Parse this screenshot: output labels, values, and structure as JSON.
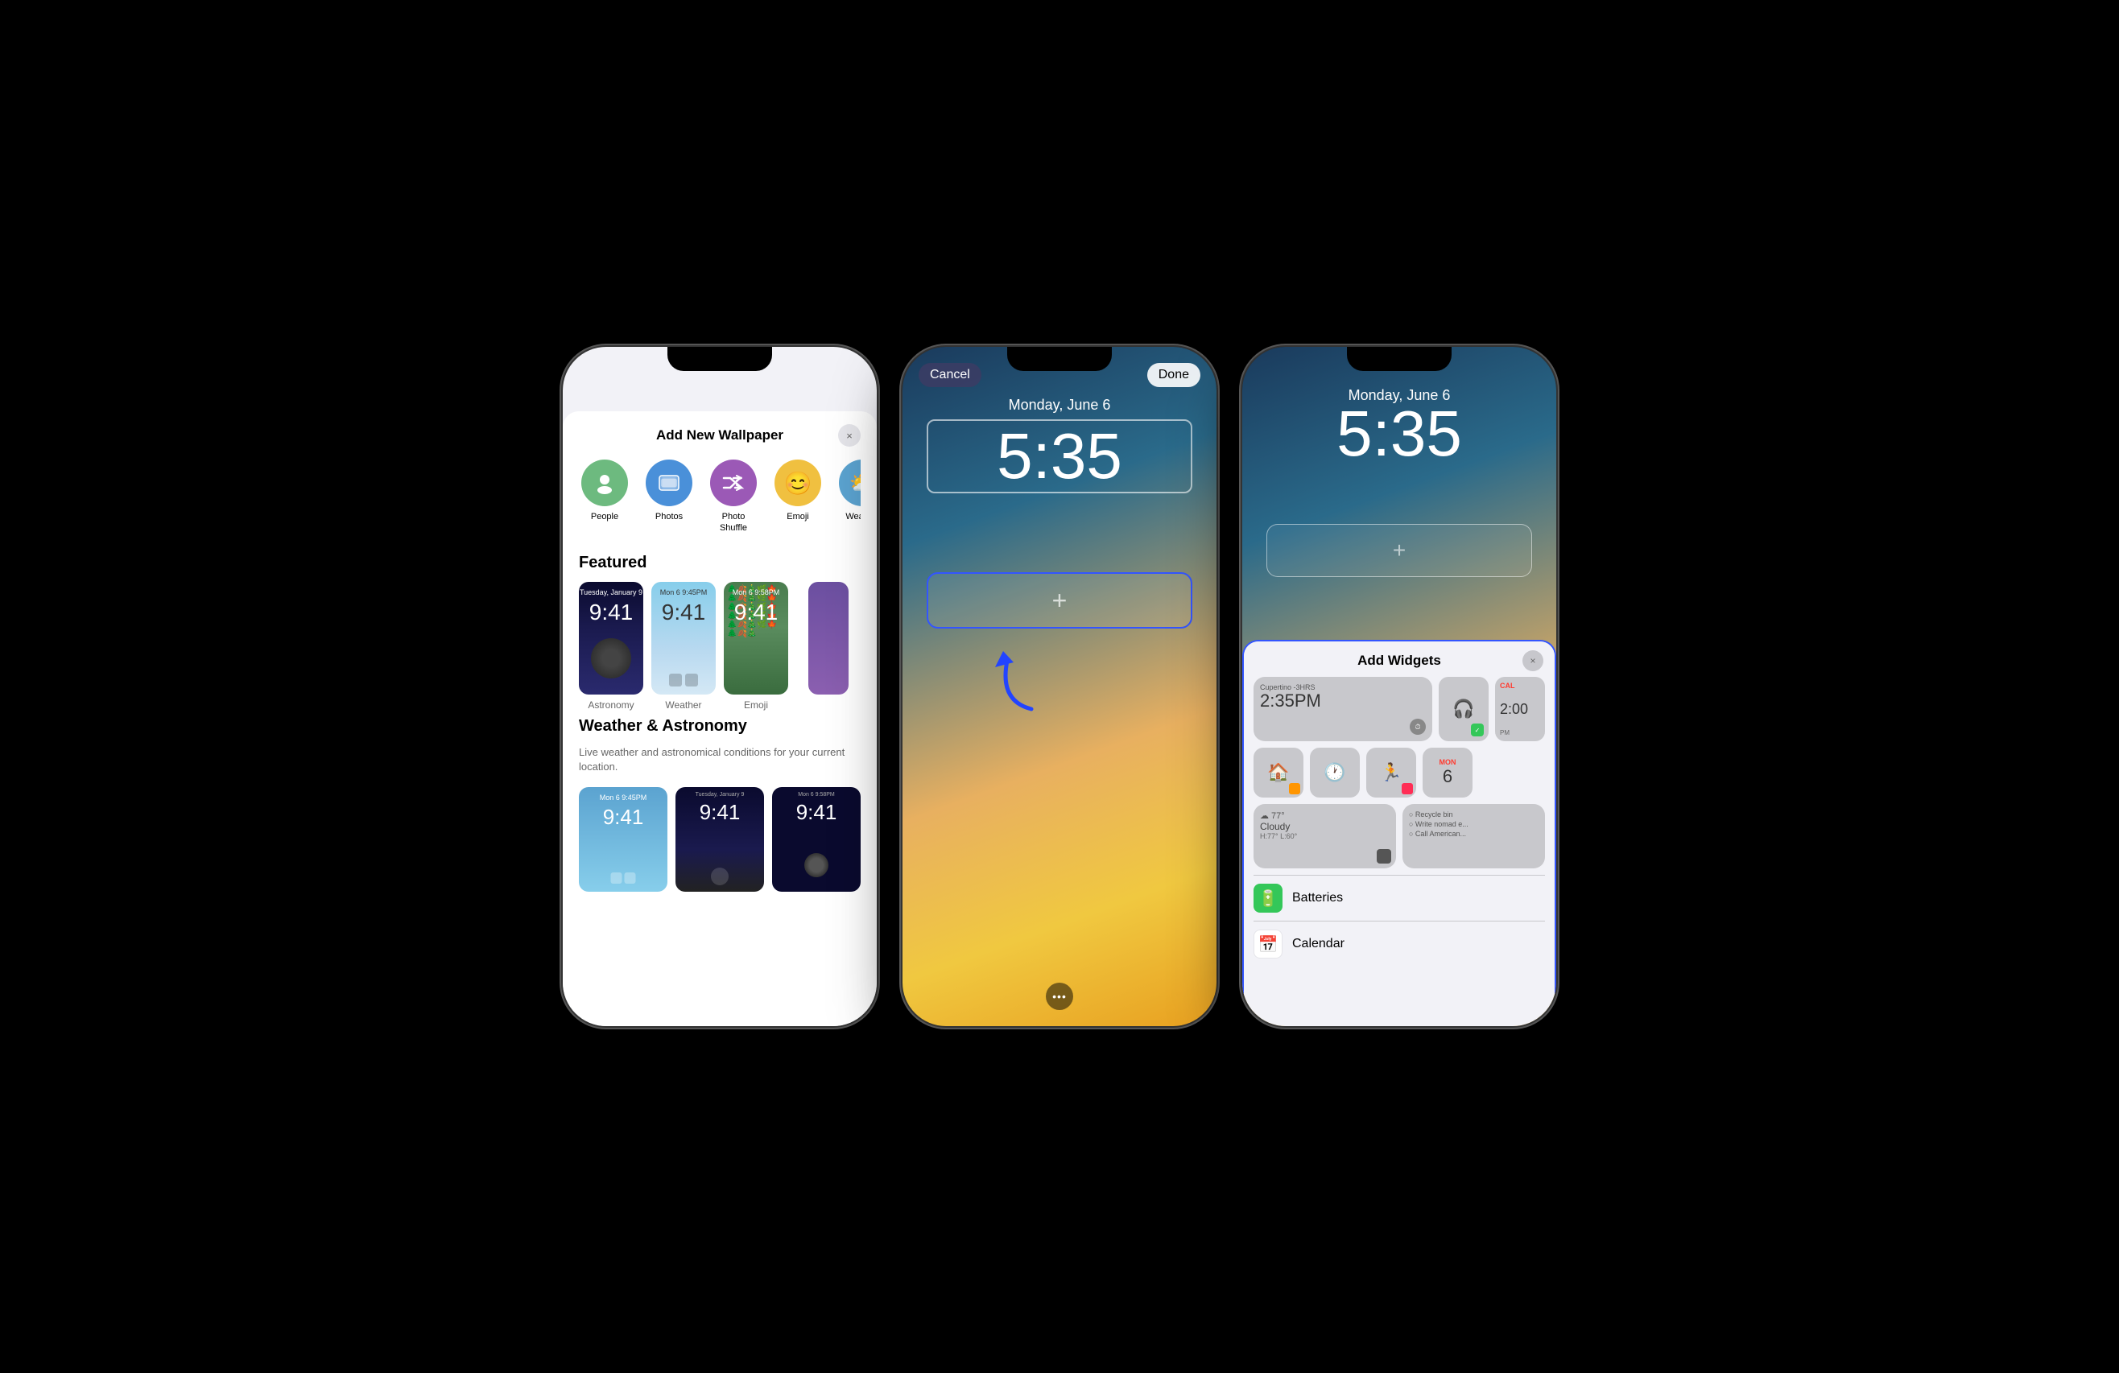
{
  "scene": {
    "bg": "#000"
  },
  "phone1": {
    "modal_title": "Add New Wallpaper",
    "close_icon": "×",
    "types": [
      {
        "id": "people",
        "label": "People",
        "emoji": "👤",
        "bg": "#6dba7f"
      },
      {
        "id": "photos",
        "label": "Photos",
        "emoji": "🖼",
        "bg": "#4a90d9"
      },
      {
        "id": "photo-shuffle",
        "label": "Photo Shuffle",
        "emoji": "🔀",
        "bg": "#9b59b6"
      },
      {
        "id": "emoji",
        "label": "Emoji",
        "emoji": "😊",
        "bg": "#f0c040"
      },
      {
        "id": "weather",
        "label": "Weather",
        "emoji": "⛅",
        "bg": "#5ba3d0"
      }
    ],
    "featured_title": "Featured",
    "featured_items": [
      {
        "label": "Astronomy"
      },
      {
        "label": "Weather"
      },
      {
        "label": "Emoji"
      }
    ],
    "weather_section_title": "Weather & Astronomy",
    "weather_section_desc": "Live weather and astronomical conditions for your current location.",
    "time_display": "9:41"
  },
  "phone2": {
    "cancel_label": "Cancel",
    "done_label": "Done",
    "date_label": "Monday, June 6",
    "time_label": "5:35",
    "plus_icon": "+",
    "dots": "•••"
  },
  "phone3": {
    "date_label": "Monday, June 6",
    "time_label": "5:35",
    "plus_icon": "+",
    "panel_title": "Add Widgets",
    "close_icon": "×",
    "widget_rows": [
      {
        "cells": [
          {
            "type": "weather-large",
            "location": "Cupertino -3HRS",
            "time": "2:35PM"
          },
          {
            "type": "airpods-small"
          },
          {
            "type": "calendar-small",
            "time": "2:00",
            "label": "PM"
          }
        ]
      },
      {
        "cells": [
          {
            "type": "home-small"
          },
          {
            "type": "clock-small"
          },
          {
            "type": "fitness-small"
          },
          {
            "type": "cal-date-small",
            "day": "MON",
            "num": "6"
          }
        ]
      },
      {
        "cells": [
          {
            "type": "weather2-large",
            "temp": "77°",
            "condition": "Cloudy",
            "range": "H:77° L:60°"
          },
          {
            "type": "reminders-large",
            "items": [
              "Recycle bin",
              "Write nomad e...",
              "Call American..."
            ]
          }
        ]
      }
    ],
    "apps": [
      {
        "name": "Batteries",
        "icon": "🔋",
        "color": "#34c759"
      },
      {
        "name": "Calendar",
        "icon": "📅",
        "color": "#ff3b30"
      }
    ]
  }
}
